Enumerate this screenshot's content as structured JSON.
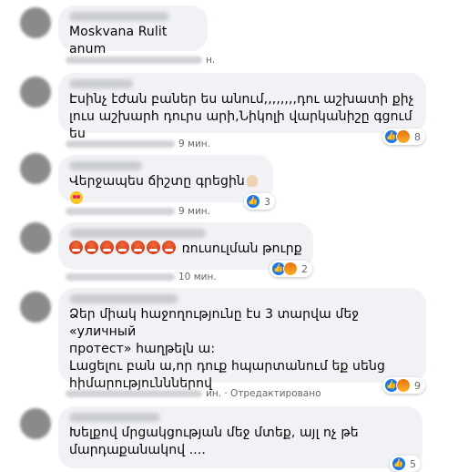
{
  "comments": [
    {
      "text": "Moskvana Rulit anum",
      "meta_time": "н."
    },
    {
      "text": "Էսինչ էժան բաներ ես անում,,,,,,,,դու աշխատի քիչ\nլուս աշխարհ դուրս արի,Նիկոլի վարկանիշը գցում ես",
      "meta_time": "9 мин.",
      "reaction_count": "8",
      "reaction_icons": [
        "like-icon",
        "angry-icon"
      ]
    },
    {
      "text": "Վերջապես ճիշտը գրեցին",
      "meta_time": "9 мин.",
      "reaction_count": "3",
      "reaction_icons": [
        "like-icon"
      ]
    },
    {
      "text": "ռուսուլման թուրք",
      "meta_time": "10 мин.",
      "reaction_count": "2",
      "reaction_icons": [
        "like-icon",
        "angry-icon"
      ]
    },
    {
      "text": "Ձեր միակ հաջողությունը էս 3 տարվա մեջ «уличный\nпротест» հաղթելն ա:\nԼացելու բան ա,որ դուք հպարտանում եք սենց\nհիմարությունններով",
      "meta_time": "ин.",
      "meta_edited": "Отредактировано",
      "reaction_count": "9",
      "reaction_icons": [
        "like-icon",
        "angry-icon"
      ]
    },
    {
      "text": "Խելքով մրցակցության մեջ մտեք, այլ ոչ թե\nմարդաքանակով ....",
      "reaction_count": "5",
      "reaction_icons": [
        "like-icon"
      ]
    }
  ],
  "colors": {
    "bubble": "#f0f2f5",
    "meta": "#65676b",
    "like": "#1877f2",
    "angry": "#e9710f"
  }
}
